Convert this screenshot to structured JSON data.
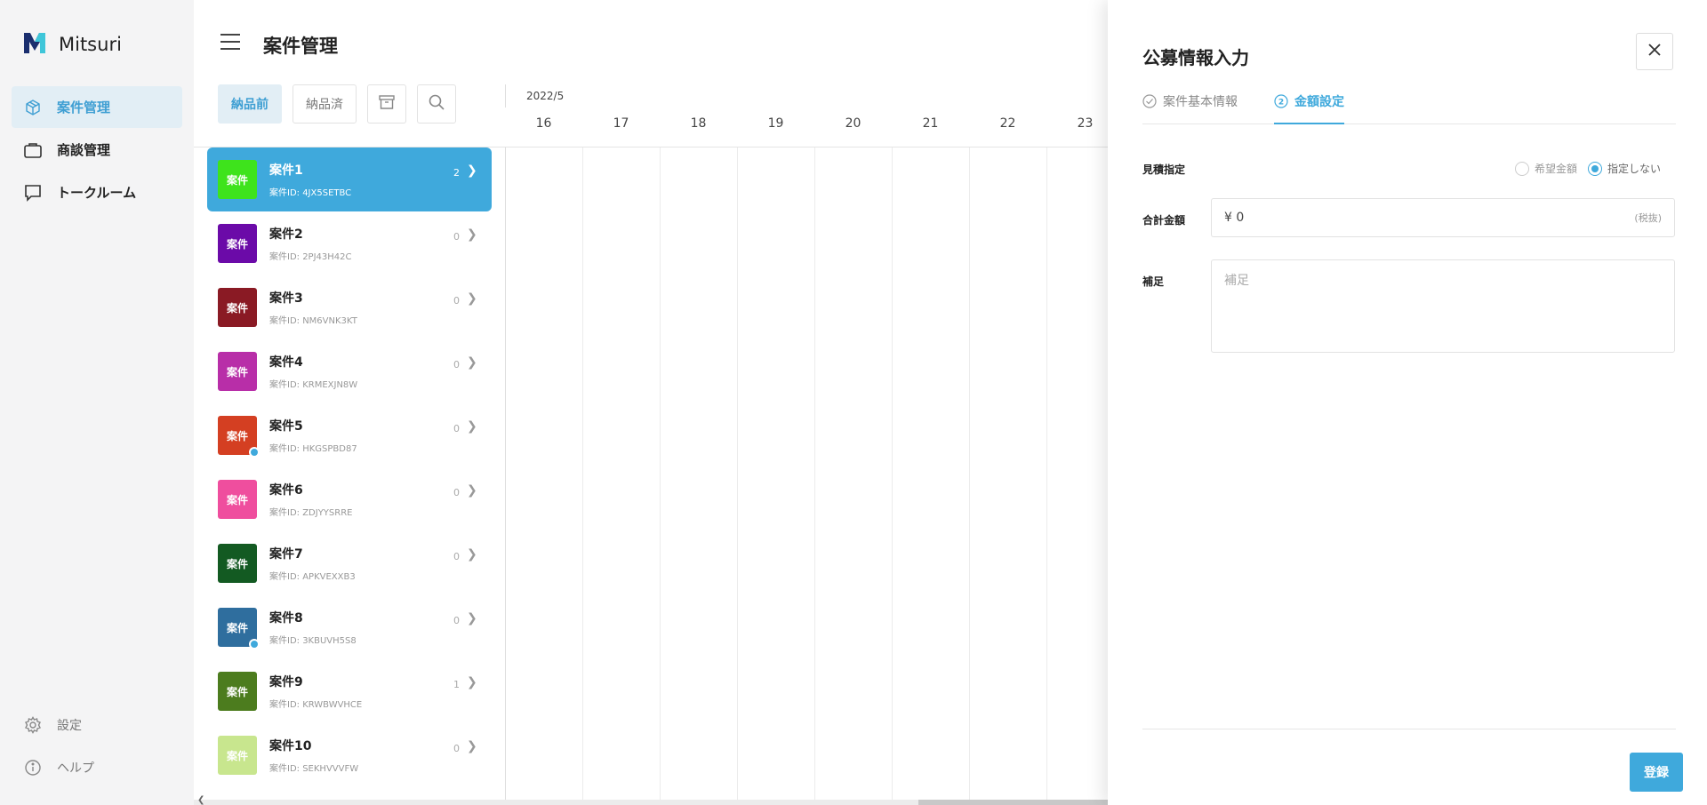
{
  "app": {
    "name": "Mitsuri"
  },
  "sidebar": {
    "items": [
      {
        "label": "案件管理",
        "icon": "cube-icon",
        "active": true
      },
      {
        "label": "商談管理",
        "icon": "briefcase-icon",
        "active": false
      },
      {
        "label": "トークルーム",
        "icon": "chat-bubble-icon",
        "active": false
      }
    ],
    "bottom": [
      {
        "label": "設定",
        "icon": "gear-icon"
      },
      {
        "label": "ヘルプ",
        "icon": "info-icon"
      }
    ]
  },
  "header": {
    "title": "案件管理"
  },
  "toolbar": {
    "tab_before_delivery": "納品前",
    "tab_delivered": "納品済",
    "archive_icon": "archive-icon",
    "search_icon": "search-icon"
  },
  "timeline": {
    "month": "2022/5",
    "days": [
      "16",
      "17",
      "18",
      "19",
      "20",
      "21",
      "22",
      "23"
    ]
  },
  "cases": [
    {
      "badge": "案件",
      "name": "案件1",
      "id": "案件ID: 4JX5SETBC",
      "count": "2",
      "color": "#3ee31c",
      "selected": true,
      "dot": false
    },
    {
      "badge": "案件",
      "name": "案件2",
      "id": "案件ID: 2PJ43H42C",
      "count": "0",
      "color": "#6b0aa8",
      "selected": false,
      "dot": false
    },
    {
      "badge": "案件",
      "name": "案件3",
      "id": "案件ID: NM6VNK3KT",
      "count": "0",
      "color": "#8a1a24",
      "selected": false,
      "dot": false
    },
    {
      "badge": "案件",
      "name": "案件4",
      "id": "案件ID: KRMEXJN8W",
      "count": "0",
      "color": "#b82ea8",
      "selected": false,
      "dot": false
    },
    {
      "badge": "案件",
      "name": "案件5",
      "id": "案件ID: HKGSPBD87",
      "count": "0",
      "color": "#d43f22",
      "selected": false,
      "dot": true
    },
    {
      "badge": "案件",
      "name": "案件6",
      "id": "案件ID: ZDJYYSRRE",
      "count": "0",
      "color": "#ef4e9e",
      "selected": false,
      "dot": false
    },
    {
      "badge": "案件",
      "name": "案件7",
      "id": "案件ID: APKVEXXB3",
      "count": "0",
      "color": "#135a22",
      "selected": false,
      "dot": false
    },
    {
      "badge": "案件",
      "name": "案件8",
      "id": "案件ID: 3KBUVH5S8",
      "count": "0",
      "color": "#2f6e9e",
      "selected": false,
      "dot": true
    },
    {
      "badge": "案件",
      "name": "案件9",
      "id": "案件ID: KRWBWVHCE",
      "count": "1",
      "color": "#4c7c1e",
      "selected": false,
      "dot": false
    },
    {
      "badge": "案件",
      "name": "案件10",
      "id": "案件ID: SEKHVVVFW",
      "count": "0",
      "color": "#c8e68e",
      "selected": false,
      "dot": false
    }
  ],
  "drawer": {
    "title": "公募情報入力",
    "tabs": [
      {
        "label": "案件基本情報",
        "icon": "check-circle-icon",
        "active": false
      },
      {
        "label": "金額設定",
        "icon": "number-2-circle-icon",
        "active": true
      }
    ],
    "estimate_label": "見積指定",
    "estimate_options": [
      {
        "label": "希望金額",
        "checked": false
      },
      {
        "label": "指定しない",
        "checked": true
      }
    ],
    "amount_label": "合計金額",
    "amount_value": "¥ 0",
    "amount_suffix": "(税抜)",
    "note_label": "補足",
    "note_placeholder": "補足",
    "submit_label": "登録"
  },
  "colors": {
    "accent": "#3fa9dc",
    "active_bg": "#e2eef5",
    "sidebar_bg": "#f4f4f5"
  }
}
